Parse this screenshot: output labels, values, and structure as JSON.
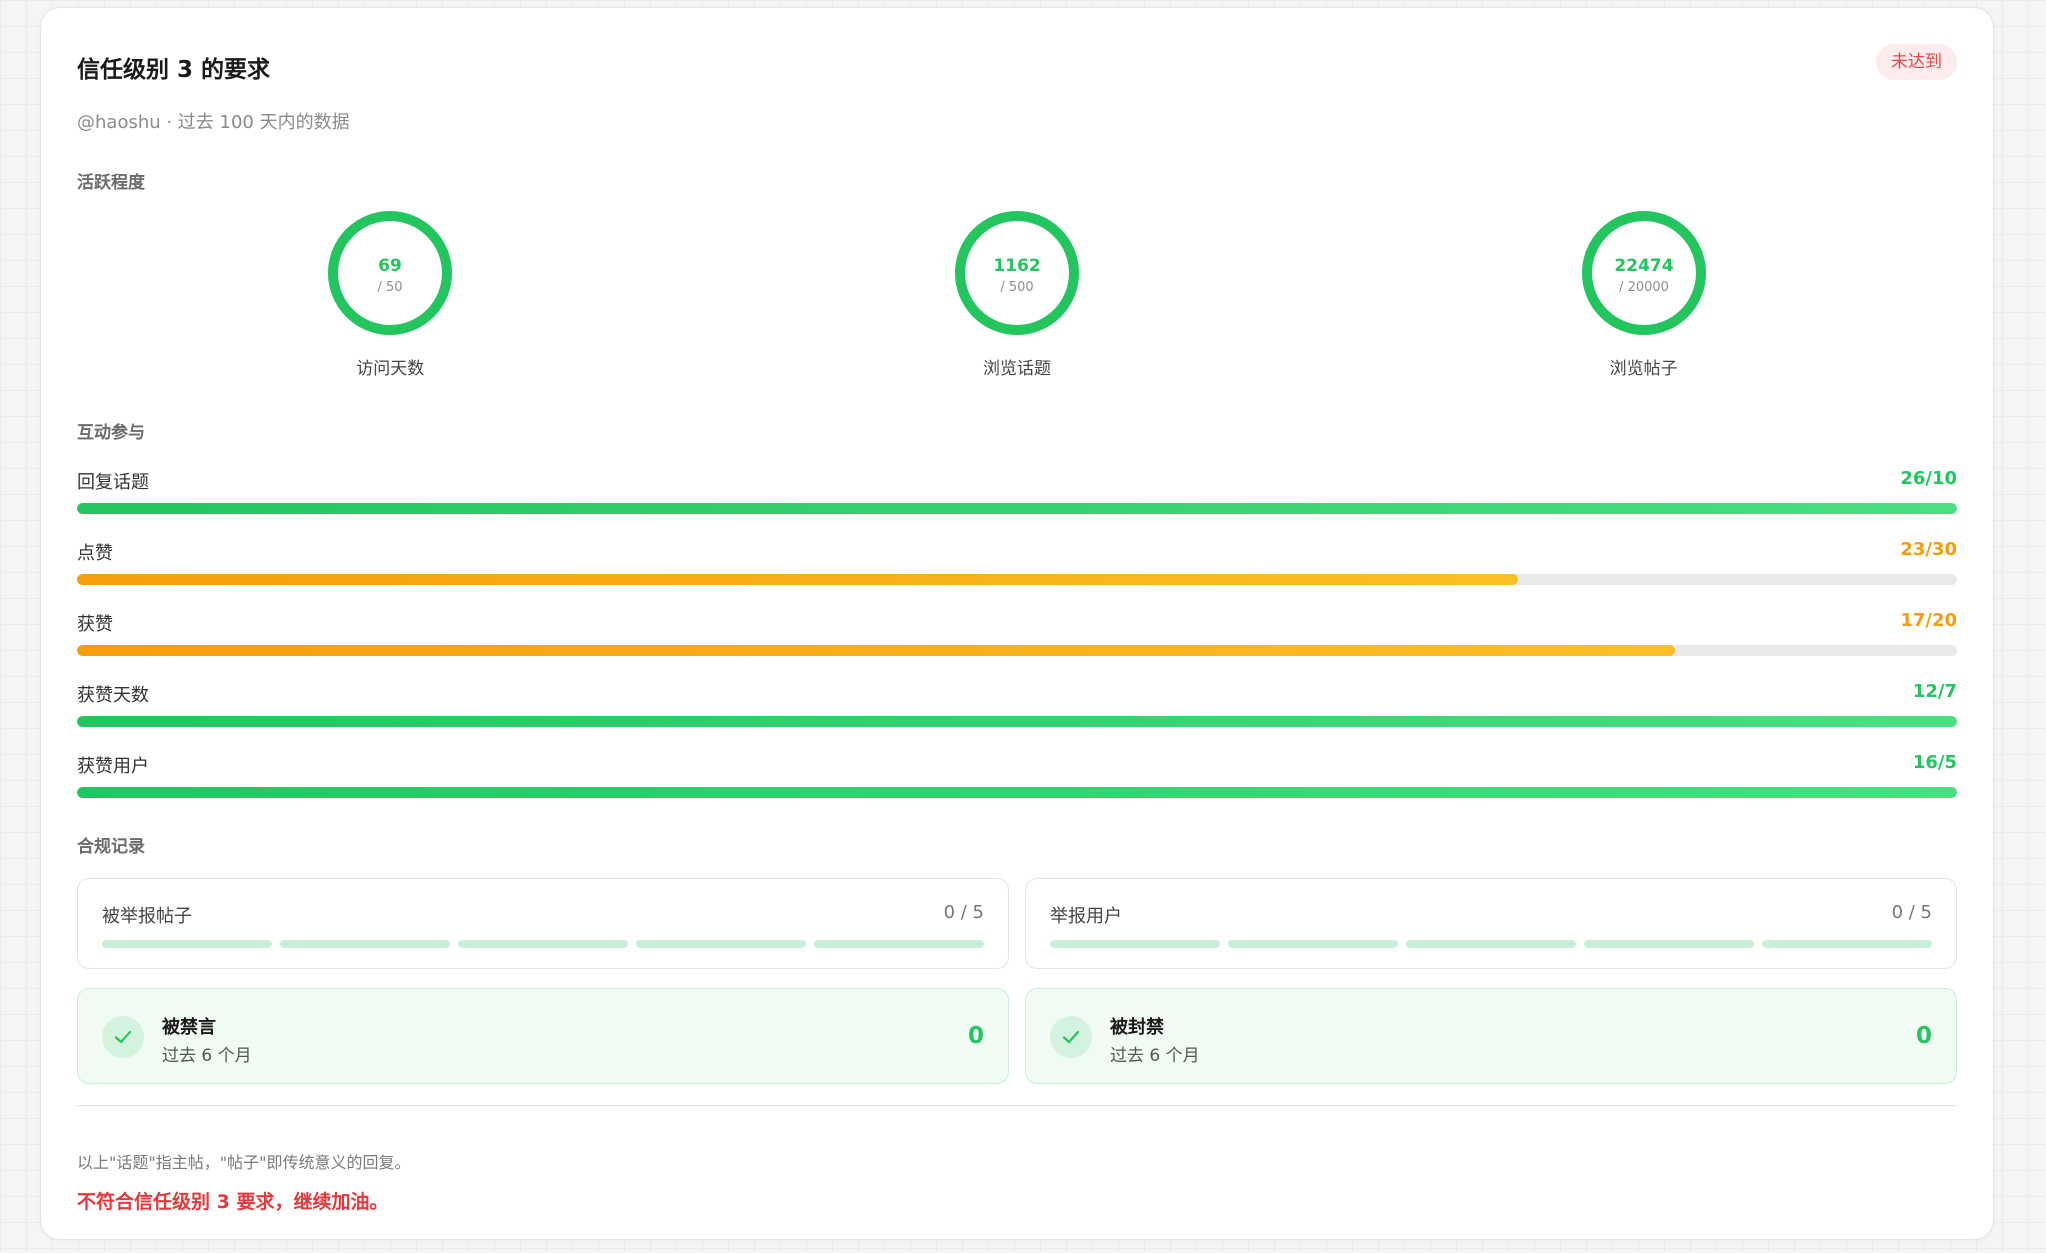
{
  "header": {
    "title": "信任级别 3 的要求",
    "badge": "未达到",
    "subtitle": "@haoshu · 过去 100 天内的数据"
  },
  "colors": {
    "success": "#22c55e",
    "warning": "#f59e0b",
    "danger": "#e5383b",
    "track": "#e9e9e9"
  },
  "activity": {
    "label": "活跃程度",
    "rings": [
      {
        "value": "69",
        "target": "/ 50",
        "label": "访问天数",
        "progress": 1
      },
      {
        "value": "1162",
        "target": "/ 500",
        "label": "浏览话题",
        "progress": 1
      },
      {
        "value": "22474",
        "target": "/ 20000",
        "label": "浏览帖子",
        "progress": 1
      }
    ]
  },
  "engagement": {
    "label": "互动参与",
    "bars": [
      {
        "label": "回复话题",
        "value": "26/10",
        "progress": 1,
        "status": "success"
      },
      {
        "label": "点赞",
        "value": "23/30",
        "progress": 0.7667,
        "status": "warning"
      },
      {
        "label": "获赞",
        "value": "17/20",
        "progress": 0.85,
        "status": "warning"
      },
      {
        "label": "获赞天数",
        "value": "12/7",
        "progress": 1,
        "status": "success"
      },
      {
        "label": "获赞用户",
        "value": "16/5",
        "progress": 1,
        "status": "success"
      }
    ]
  },
  "compliance": {
    "label": "合规记录",
    "counters": [
      {
        "label": "被举报帖子",
        "value": "0 / 5",
        "used": 0,
        "max": 5
      },
      {
        "label": "举报用户",
        "value": "0 / 5",
        "used": 0,
        "max": 5
      }
    ],
    "bans": [
      {
        "title": "被禁言",
        "subtitle": "过去 6 个月",
        "count": "0",
        "icon": "check-icon"
      },
      {
        "title": "被封禁",
        "subtitle": "过去 6 个月",
        "count": "0",
        "icon": "check-icon"
      }
    ]
  },
  "footer": {
    "note": "以上\"话题\"指主帖，\"帖子\"即传统意义的回复。",
    "result": "不符合信任级别 3 要求，继续加油。"
  }
}
